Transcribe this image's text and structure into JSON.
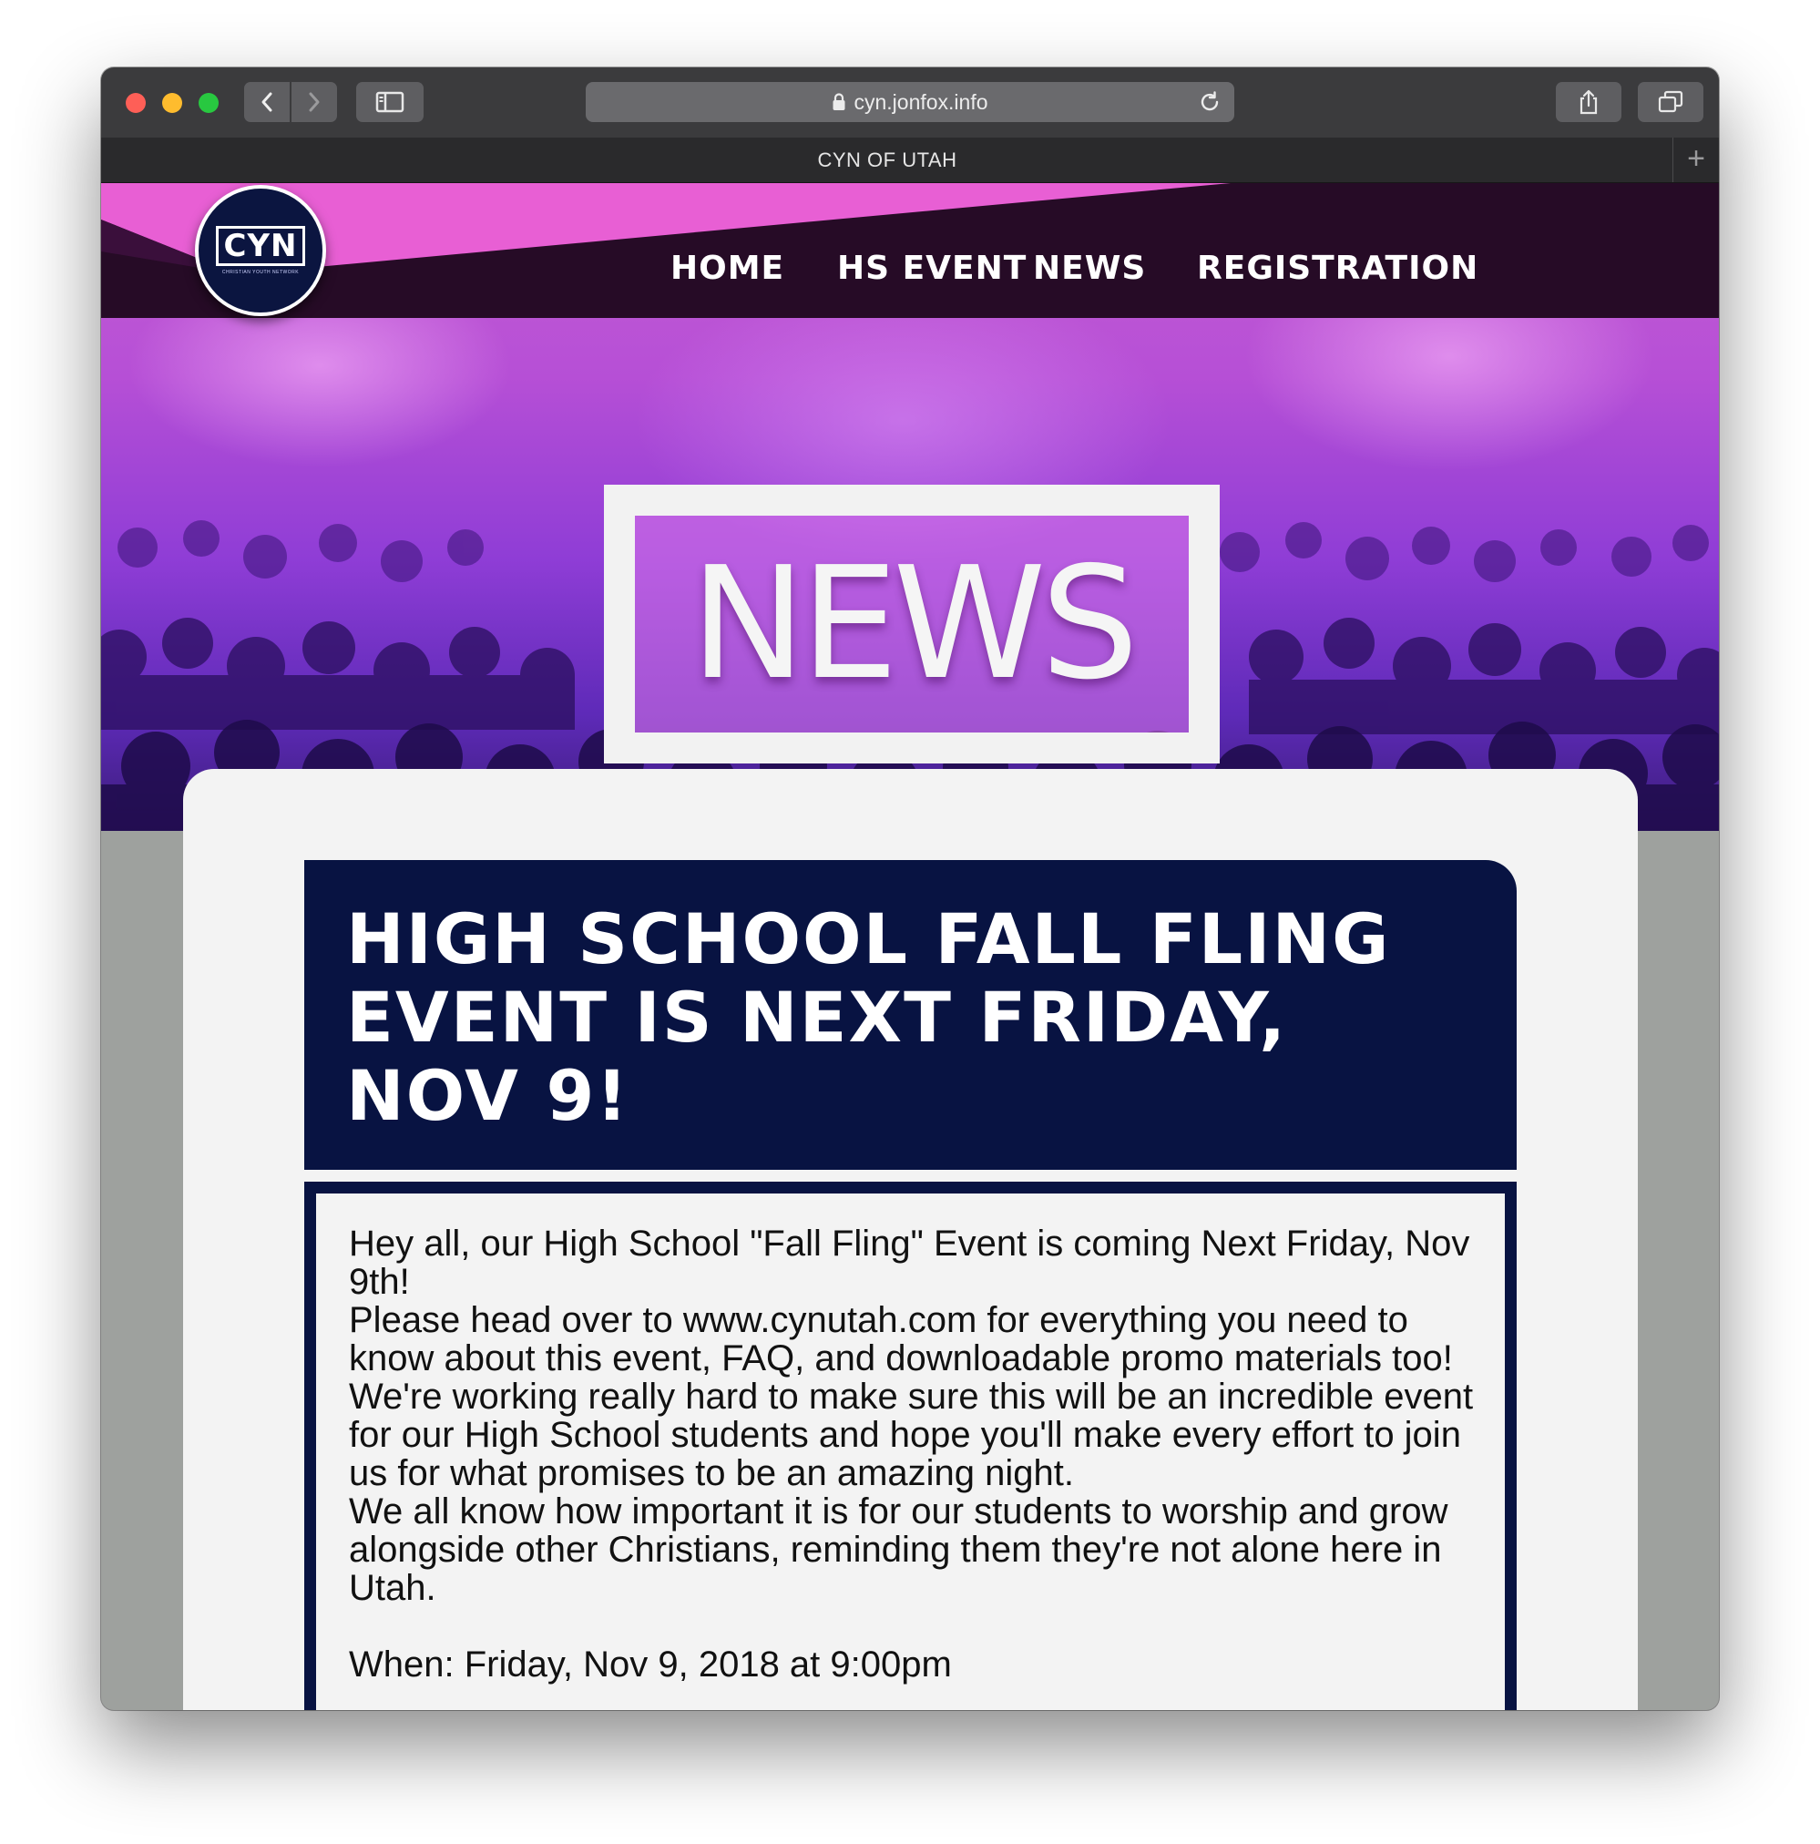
{
  "browser": {
    "url": "cyn.jonfox.info",
    "tab_title": "CYN OF UTAH"
  },
  "site": {
    "logo_text": "CYN",
    "logo_subtext": "CHRISTIAN YOUTH NETWORK",
    "nav": [
      "HOME",
      "HS EVENT",
      "NEWS",
      "REGISTRATION"
    ],
    "hero_title": "NEWS"
  },
  "article": {
    "headline": "HIGH SCHOOL FALL FLING EVENT IS NEXT FRIDAY, NOV 9!",
    "paragraphs": [
      "Hey all, our High School \"Fall Fling\" Event is coming Next Friday, Nov 9th!",
      "Please head over to www.cynutah.com for everything you need to know about this event, FAQ, and downloadable promo materials too! We're working really hard to make sure this will be an incredible event for our High School students and hope you'll make every effort to join us for what promises to be an amazing night.",
      "We all know how important it is for our students to worship and grow alongside other Christians, reminding them they're not alone here in Utah.",
      "When: Friday, Nov 9, 2018 at 9:00pm"
    ]
  },
  "colors": {
    "header_bg": "#260b26",
    "accent_pink": "#e85fd4",
    "navy": "#081342",
    "card_bg": "#f3f3f3"
  }
}
